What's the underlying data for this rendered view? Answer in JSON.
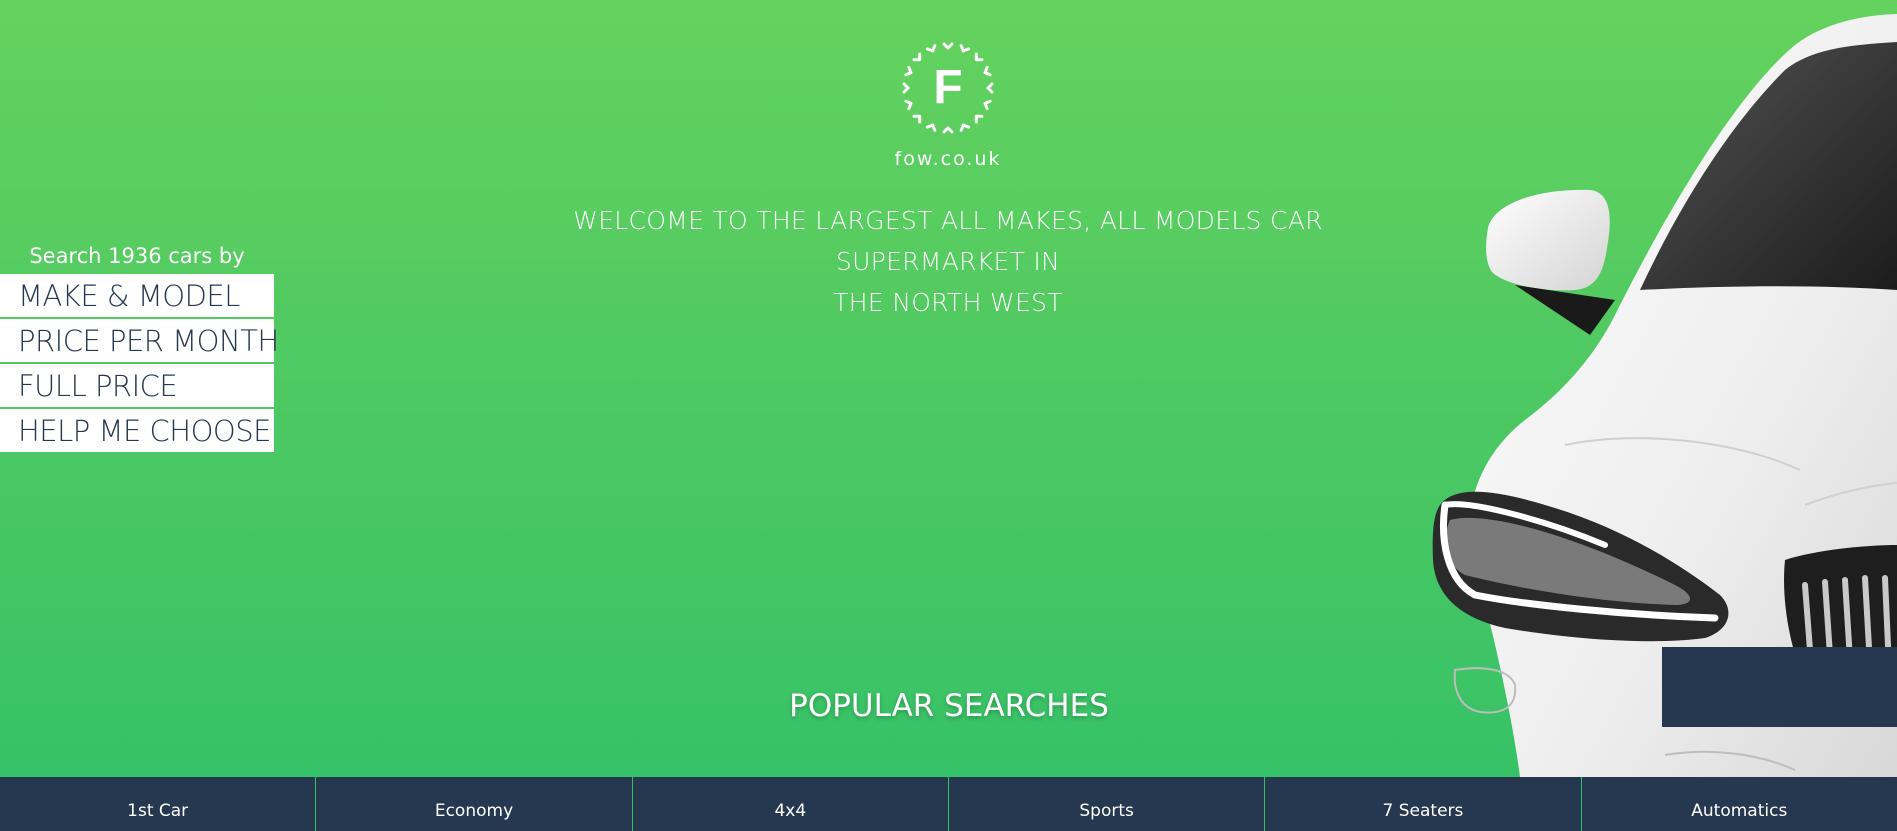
{
  "logo": {
    "letter": "F",
    "domain": "fow.co.uk"
  },
  "welcome": {
    "line1": "WELCOME TO THE LARGEST ALL MAKES, ALL MODELS CAR SUPERMARKET IN",
    "line2": "THE NORTH WEST"
  },
  "search": {
    "title": "Search 1936 cars by",
    "options": [
      "MAKE & MODEL",
      "PRICE PER MONTH",
      "FULL PRICE",
      "HELP ME CHOOSE"
    ]
  },
  "popular": {
    "title": "POPULAR SEARCHES"
  },
  "bottom_nav": [
    "1st Car",
    "Economy",
    "4x4",
    "Sports",
    "7 Seaters",
    "Automatics"
  ],
  "colors": {
    "accent": "#33c168",
    "navy": "#263750",
    "white": "#ffffff"
  }
}
